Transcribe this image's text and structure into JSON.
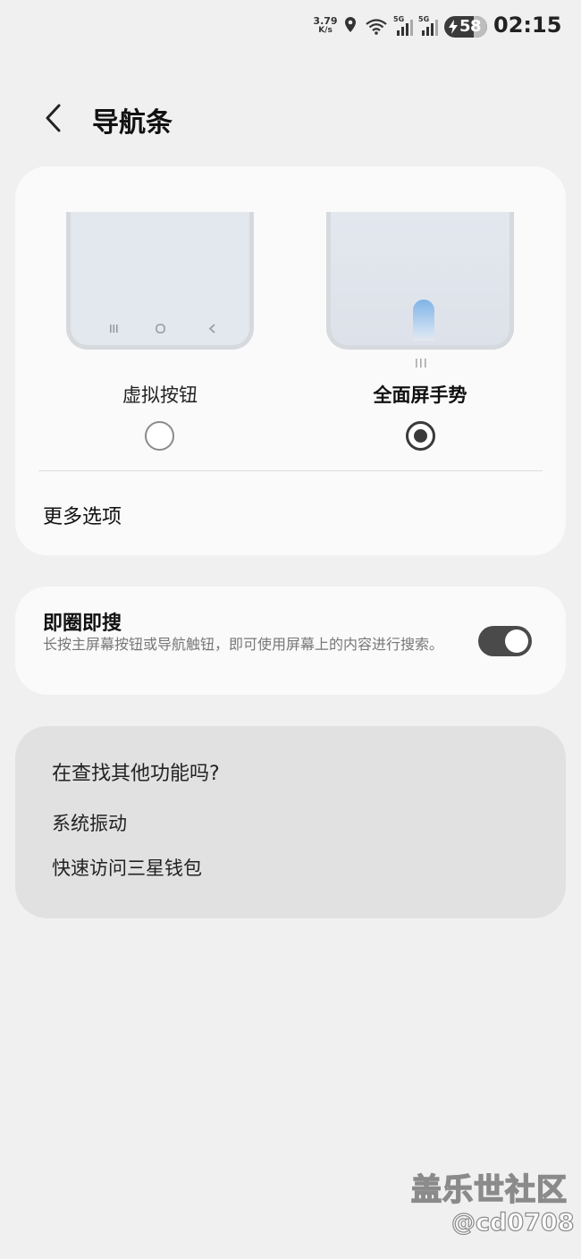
{
  "status_bar": {
    "speed_value": "3.79",
    "speed_unit": "K/s",
    "net_label_1": "5G",
    "net_label_2": "5G",
    "battery_level": "58",
    "time": "02:15",
    "icons": [
      "location-icon",
      "wifi-icon",
      "signal-icon",
      "signal-icon",
      "battery-charging-icon"
    ]
  },
  "header": {
    "title": "导航条",
    "back_icon": "chevron-left-icon"
  },
  "navigation_type": {
    "options": [
      {
        "label": "虚拟按钮",
        "selected": false
      },
      {
        "label": "全面屏手势",
        "selected": true
      }
    ],
    "more_options_label": "更多选项"
  },
  "circle_to_search": {
    "title": "即圈即搜",
    "description": "长按主屏幕按钮或导航触钮，即可使用屏幕上的内容进行搜索。",
    "enabled": true
  },
  "looking_for_more": {
    "title": "在查找其他功能吗?",
    "links": [
      "系统振动",
      "快速访问三星钱包"
    ]
  },
  "watermark": {
    "site": "盖乐世社区",
    "user": "@cd0708"
  },
  "colors": {
    "background": "#f0f0f0",
    "card": "#fafafa",
    "suggestion_card": "#e1e1e1",
    "toggle_on": "#4a4a4a",
    "gesture_accent": "#7fb3e6"
  }
}
